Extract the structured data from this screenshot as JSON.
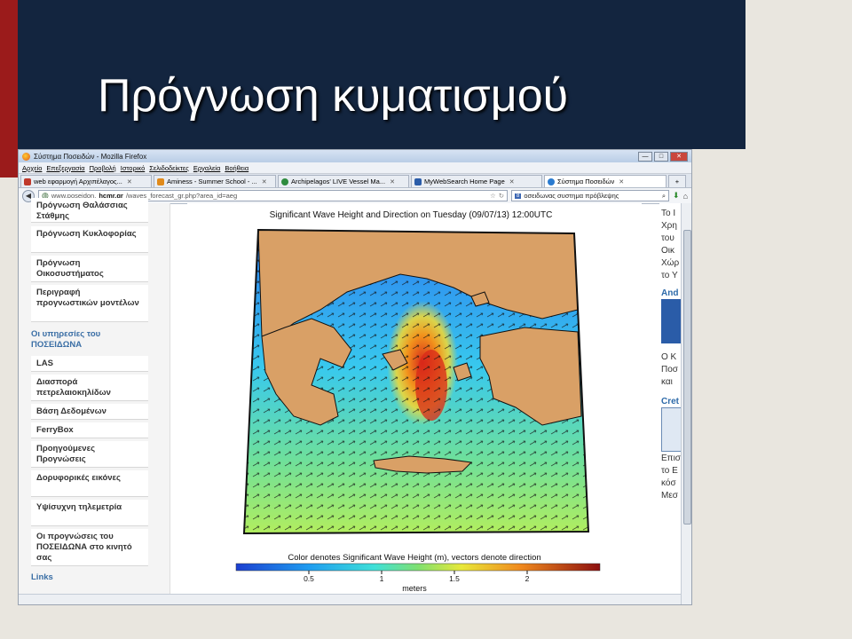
{
  "slide": {
    "title": "Πρόγνωση κυματισμού"
  },
  "window": {
    "title": "Σύστημα Ποσειδών - Mozilla Firefox",
    "min": "—",
    "max": "□",
    "close": "✕"
  },
  "menu": [
    "Αρχείο",
    "Επεξεργασία",
    "Προβολή",
    "Ιστορικό",
    "Σελιδοδείκτες",
    "Εργαλεία",
    "Βοήθεια"
  ],
  "tabs": [
    {
      "label": "web εφαρμογή Αρχιπέλαγος...",
      "color": "#c0392b"
    },
    {
      "label": "Aminess - Summer School - ...",
      "color": "#e08a1b"
    },
    {
      "label": "Archipelagos' LIVE Vessel Ma...",
      "color": "#2e8b3e"
    },
    {
      "label": "MyWebSearch Home Page",
      "color": "#2a5ca8"
    },
    {
      "label": "Σύστημα Ποσειδών",
      "color": "#2a7bd0"
    }
  ],
  "tab_add": "+",
  "url": {
    "prefix": "www.poseidon.",
    "host": "hcmr.gr",
    "path": "/waves_forecast_gr.php?area_id=aeg"
  },
  "search": {
    "value": "οσειδωνας συστημα πρόβλεψης"
  },
  "sidebar": {
    "items": [
      "Πρόγνωση Θαλάσσιας Στάθμης",
      "Πρόγνωση Κυκλοφορίας",
      "Πρόγνωση Οικοσυστήματος",
      "Περιγραφή προγνωστικών μοντέλων"
    ],
    "section": "Οι υπηρεσίες του ΠΟΣΕΙΔΩΝΑ",
    "items2": [
      "LAS",
      "Διασπορά πετρελαιοκηλίδων",
      "Βάση Δεδομένων",
      "FerryBox",
      "Προηγούμενες Προγνώσεις",
      "Δορυφορικές εικόνες",
      "Υψίσυχνη τηλεμετρία",
      "Οι προγνώσεις του ΠΟΣΕΙΔΩΝΑ στο κινητό σας"
    ],
    "links": "Links"
  },
  "map": {
    "title": "Significant Wave Height and Direction on Tuesday (09/07/13) 12:00UTC",
    "caption": "Color denotes Significant Wave Height (m), vectors denote direction",
    "ticks": [
      "0.5",
      "1",
      "1.5",
      "2"
    ],
    "unit": "meters",
    "colors": {
      "land": "#d9a066",
      "sea_low": "#1e6ee8",
      "sea_mid": "#7fe07a",
      "sea_high": "#d8281a"
    }
  },
  "right": {
    "lines": [
      "Το Ι",
      "Χρη",
      "του",
      "Οικ",
      "Χώρ",
      "το Υ"
    ],
    "heading1": "And",
    "lines2": [
      "Ο Κ",
      "Ποσ",
      "και"
    ],
    "heading2": "Cret",
    "lines3": [
      "Επισ",
      "το Ε",
      "κόσ",
      "Μεσ"
    ]
  }
}
